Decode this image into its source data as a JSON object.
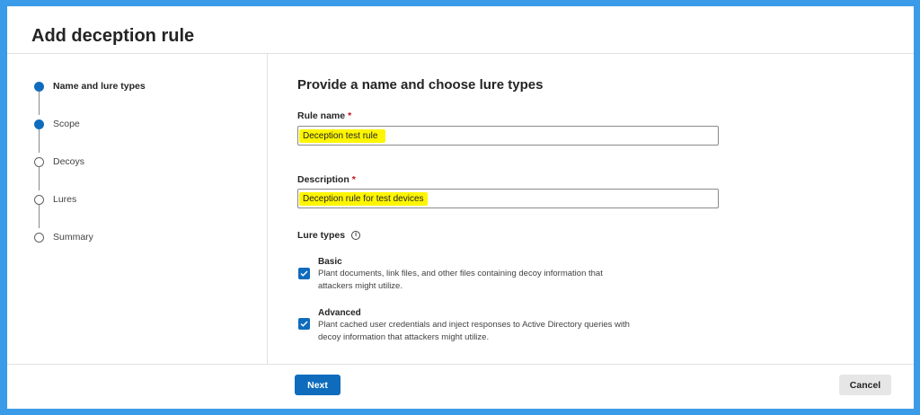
{
  "dialog": {
    "title": "Add deception rule"
  },
  "steps": [
    {
      "label": "Name and lure types",
      "state": "current"
    },
    {
      "label": "Scope",
      "state": "completed"
    },
    {
      "label": "Decoys",
      "state": "pending"
    },
    {
      "label": "Lures",
      "state": "pending"
    },
    {
      "label": "Summary",
      "state": "pending"
    }
  ],
  "form": {
    "heading": "Provide a name and choose lure types",
    "rule_name": {
      "label": "Rule name",
      "required_mark": "*",
      "value": "Deception test rule"
    },
    "description": {
      "label": "Description",
      "required_mark": "*",
      "value": "Deception rule for test devices"
    },
    "lure_types": {
      "label": "Lure types",
      "info_glyph": "i",
      "options": [
        {
          "title": "Basic",
          "checked": true,
          "desc_line1": "Plant documents, link files, and other files containing decoy information that",
          "desc_line2": "attackers might utilize."
        },
        {
          "title": "Advanced",
          "checked": true,
          "desc_line1": "Plant cached user credentials and inject responses to Active Directory queries with",
          "desc_line2": "decoy information that attackers might utilize."
        }
      ]
    }
  },
  "footer": {
    "next_label": "Next",
    "cancel_label": "Cancel"
  },
  "colors": {
    "accent": "#0f6cbd",
    "highlight": "#fef500",
    "frame": "#3a9be8",
    "required": "#c50f1f"
  }
}
